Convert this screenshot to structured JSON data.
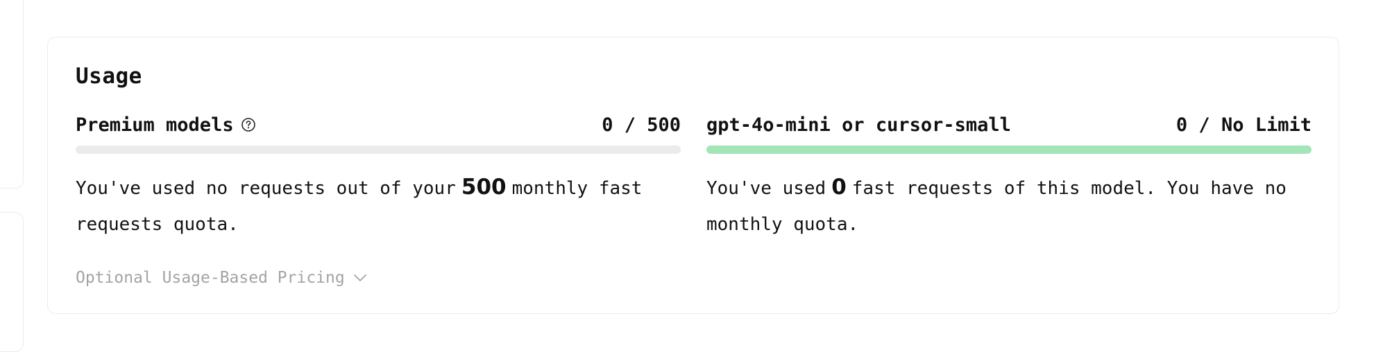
{
  "usage": {
    "title": "Usage",
    "premium": {
      "label": "Premium models",
      "count": "0 / 500",
      "progress_fraction": 0.0,
      "bar_track_color": "#ebebeb",
      "bar_fill_color": "#a3e4b8",
      "desc_before": "You've used no requests out of your",
      "desc_number": "500",
      "desc_after": "monthly fast requests quota."
    },
    "small": {
      "label": "gpt-4o-mini or cursor-small",
      "count": "0 / No Limit",
      "progress_fraction": 1.0,
      "bar_fill_color": "#a3e4b8",
      "desc_before": "You've used",
      "desc_number": "0",
      "desc_after": "fast requests of this model. You have no monthly quota."
    },
    "optional_pricing_label": "Optional Usage-Based Pricing",
    "icons": {
      "help": "help-circle-icon",
      "expand": "chevron-down-icon"
    }
  }
}
